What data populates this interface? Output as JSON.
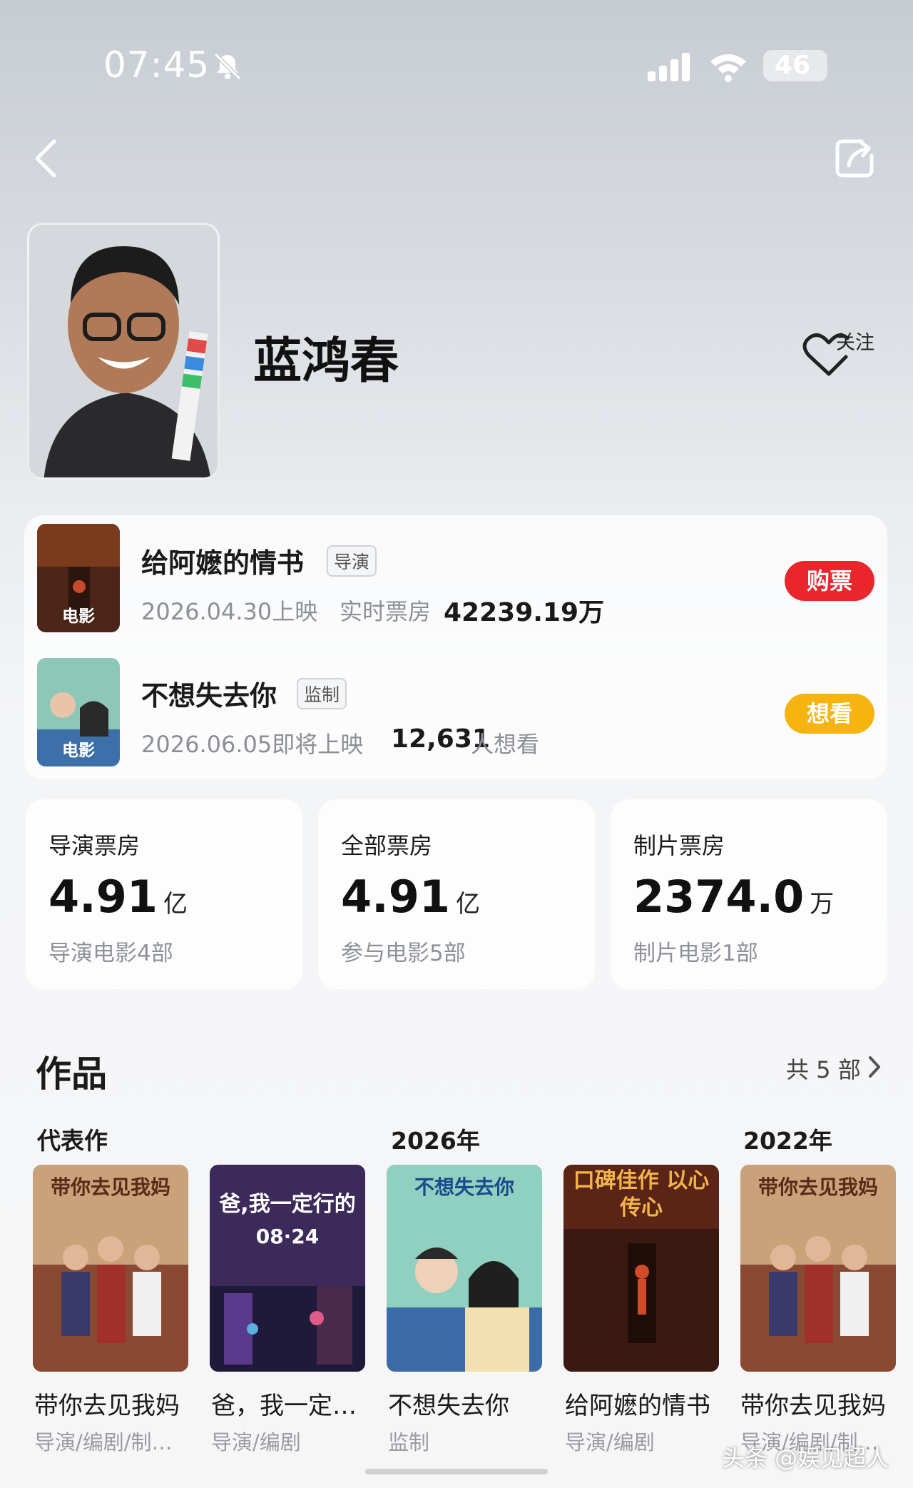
{
  "status_bar": {
    "time": "07:45",
    "battery": "46",
    "icons": [
      "bell-muted-icon",
      "signal-icon",
      "wifi-icon",
      "battery-icon"
    ]
  },
  "nav": {
    "back_icon": "chevron-left-icon",
    "share_icon": "share-icon"
  },
  "profile": {
    "name": "蓝鸿春",
    "follow_label": "关注",
    "follow_icon": "heart-plus-icon"
  },
  "recent_films": [
    {
      "title": "给阿嬷的情书",
      "role": "导演",
      "tag": "电影",
      "date": "2026.04.30上映",
      "metric_label": "实时票房",
      "metric_value": "42239.19万",
      "action": "购票",
      "action_color": "#e8262c"
    },
    {
      "title": "不想失去你",
      "role": "监制",
      "tag": "电影",
      "date": "2026.06.05即将上映",
      "metric_value": "12,631",
      "metric_suffix": "人想看",
      "action": "想看",
      "action_color": "#f5b40f"
    }
  ],
  "stats": [
    {
      "label": "导演票房",
      "value": "4.91",
      "unit": "亿",
      "sub": "导演电影4部"
    },
    {
      "label": "全部票房",
      "value": "4.91",
      "unit": "亿",
      "sub": "参与电影5部"
    },
    {
      "label": "制片票房",
      "value": "2374.0",
      "unit": "万",
      "sub": "制片电影1部"
    }
  ],
  "works": {
    "title": "作品",
    "count": "共 5 部",
    "groups": [
      "代表作",
      "2026年",
      "2022年"
    ],
    "items": [
      {
        "title": "带你去见我妈",
        "role": "导演/编剧/制…",
        "poster_text": "带你去见我妈"
      },
      {
        "title": "爸，我一定…",
        "role": "导演/编剧",
        "poster_text": "爸,我一定行的",
        "poster_date": "08·24"
      },
      {
        "title": "不想失去你",
        "role": "监制",
        "poster_text": "不想失去你"
      },
      {
        "title": "给阿嬷的情书",
        "role": "导演/编剧",
        "poster_text": "口碑佳作 以心传心"
      },
      {
        "title": "带你去见我妈",
        "role": "导演/编剧/制…",
        "poster_text": "带你去见我妈"
      }
    ]
  },
  "watermark": "头条 @娱见超人"
}
